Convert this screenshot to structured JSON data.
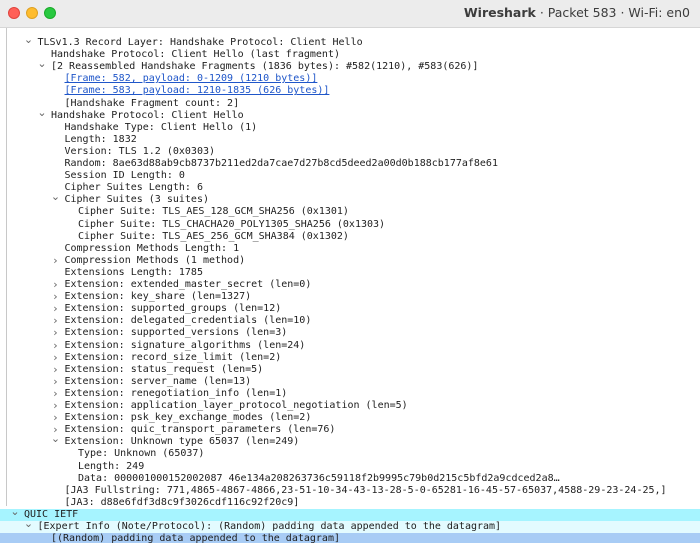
{
  "window": {
    "app_name": "Wireshark",
    "subtitle": "· Packet 583 · Wi-Fi: en0"
  },
  "tree": [
    {
      "text": "TLSv1.3 Record Layer: Handshake Protocol: Client Hello",
      "indent": 1,
      "arrow": "down"
    },
    {
      "text": "Handshake Protocol: Client Hello (last fragment)",
      "indent": 2,
      "arrow": "none"
    },
    {
      "text": "[2 Reassembled Handshake Fragments (1836 bytes): #582(1210), #583(626)]",
      "indent": 2,
      "arrow": "down"
    },
    {
      "text": "[Frame: 582, payload: 0-1209 (1210 bytes)]",
      "indent": 3,
      "arrow": "none",
      "link": true
    },
    {
      "text": "[Frame: 583, payload: 1210-1835 (626 bytes)]",
      "indent": 3,
      "arrow": "none",
      "link": true
    },
    {
      "text": "[Handshake Fragment count: 2]",
      "indent": 3,
      "arrow": "none"
    },
    {
      "text": "Handshake Protocol: Client Hello",
      "indent": 2,
      "arrow": "down"
    },
    {
      "text": "Handshake Type: Client Hello (1)",
      "indent": 3,
      "arrow": "none"
    },
    {
      "text": "Length: 1832",
      "indent": 3,
      "arrow": "none"
    },
    {
      "text": "Version: TLS 1.2 (0x0303)",
      "indent": 3,
      "arrow": "none"
    },
    {
      "text": "Random: 8ae63d88ab9cb8737b211ed2da7cae7d27b8cd5deed2a00d0b188cb177af8e61",
      "indent": 3,
      "arrow": "none"
    },
    {
      "text": "Session ID Length: 0",
      "indent": 3,
      "arrow": "none"
    },
    {
      "text": "Cipher Suites Length: 6",
      "indent": 3,
      "arrow": "none"
    },
    {
      "text": "Cipher Suites (3 suites)",
      "indent": 3,
      "arrow": "down"
    },
    {
      "text": "Cipher Suite: TLS_AES_128_GCM_SHA256 (0x1301)",
      "indent": 4,
      "arrow": "none"
    },
    {
      "text": "Cipher Suite: TLS_CHACHA20_POLY1305_SHA256 (0x1303)",
      "indent": 4,
      "arrow": "none"
    },
    {
      "text": "Cipher Suite: TLS_AES_256_GCM_SHA384 (0x1302)",
      "indent": 4,
      "arrow": "none"
    },
    {
      "text": "Compression Methods Length: 1",
      "indent": 3,
      "arrow": "none"
    },
    {
      "text": "Compression Methods (1 method)",
      "indent": 3,
      "arrow": "right"
    },
    {
      "text": "Extensions Length: 1785",
      "indent": 3,
      "arrow": "none"
    },
    {
      "text": "Extension: extended_master_secret (len=0)",
      "indent": 3,
      "arrow": "right"
    },
    {
      "text": "Extension: key_share (len=1327)",
      "indent": 3,
      "arrow": "right"
    },
    {
      "text": "Extension: supported_groups (len=12)",
      "indent": 3,
      "arrow": "right"
    },
    {
      "text": "Extension: delegated_credentials (len=10)",
      "indent": 3,
      "arrow": "right"
    },
    {
      "text": "Extension: supported_versions (len=3)",
      "indent": 3,
      "arrow": "right"
    },
    {
      "text": "Extension: signature_algorithms (len=24)",
      "indent": 3,
      "arrow": "right"
    },
    {
      "text": "Extension: record_size_limit (len=2)",
      "indent": 3,
      "arrow": "right"
    },
    {
      "text": "Extension: status_request (len=5)",
      "indent": 3,
      "arrow": "right"
    },
    {
      "text": "Extension: server_name (len=13)",
      "indent": 3,
      "arrow": "right"
    },
    {
      "text": "Extension: renegotiation_info (len=1)",
      "indent": 3,
      "arrow": "right"
    },
    {
      "text": "Extension: application_layer_protocol_negotiation (len=5)",
      "indent": 3,
      "arrow": "right"
    },
    {
      "text": "Extension: psk_key_exchange_modes (len=2)",
      "indent": 3,
      "arrow": "right"
    },
    {
      "text": "Extension: quic_transport_parameters (len=76)",
      "indent": 3,
      "arrow": "right"
    },
    {
      "text": "Extension: Unknown type 65037 (len=249)",
      "indent": 3,
      "arrow": "down"
    },
    {
      "text": "Type: Unknown (65037)",
      "indent": 4,
      "arrow": "none"
    },
    {
      "text": "Length: 249",
      "indent": 4,
      "arrow": "none"
    },
    {
      "text": "Data: 000001000152002087 46e134a208263736c59118f2b9995c79b0d215c5bfd2a9cdced2a8…",
      "indent": 4,
      "arrow": "none"
    },
    {
      "text": "[JA3 Fullstring: 771,4865-4867-4866,23-51-10-34-43-13-28-5-0-65281-16-45-57-65037,4588-29-23-24-25,]",
      "indent": 3,
      "arrow": "none"
    },
    {
      "text": "[JA3: d88e6fdf3d8c9f3026cdf116c92f20c9]",
      "indent": 3,
      "arrow": "none"
    },
    {
      "text": "QUIC IETF",
      "indent": 0,
      "arrow": "down",
      "highlight": "hl1"
    },
    {
      "text": "[Expert Info (Note/Protocol): (Random) padding data appended to the datagram]",
      "indent": 1,
      "arrow": "down",
      "highlight": "hl2"
    },
    {
      "text": "[(Random) padding data appended to the datagram]",
      "indent": 2,
      "arrow": "none",
      "highlight": "hl3"
    }
  ]
}
